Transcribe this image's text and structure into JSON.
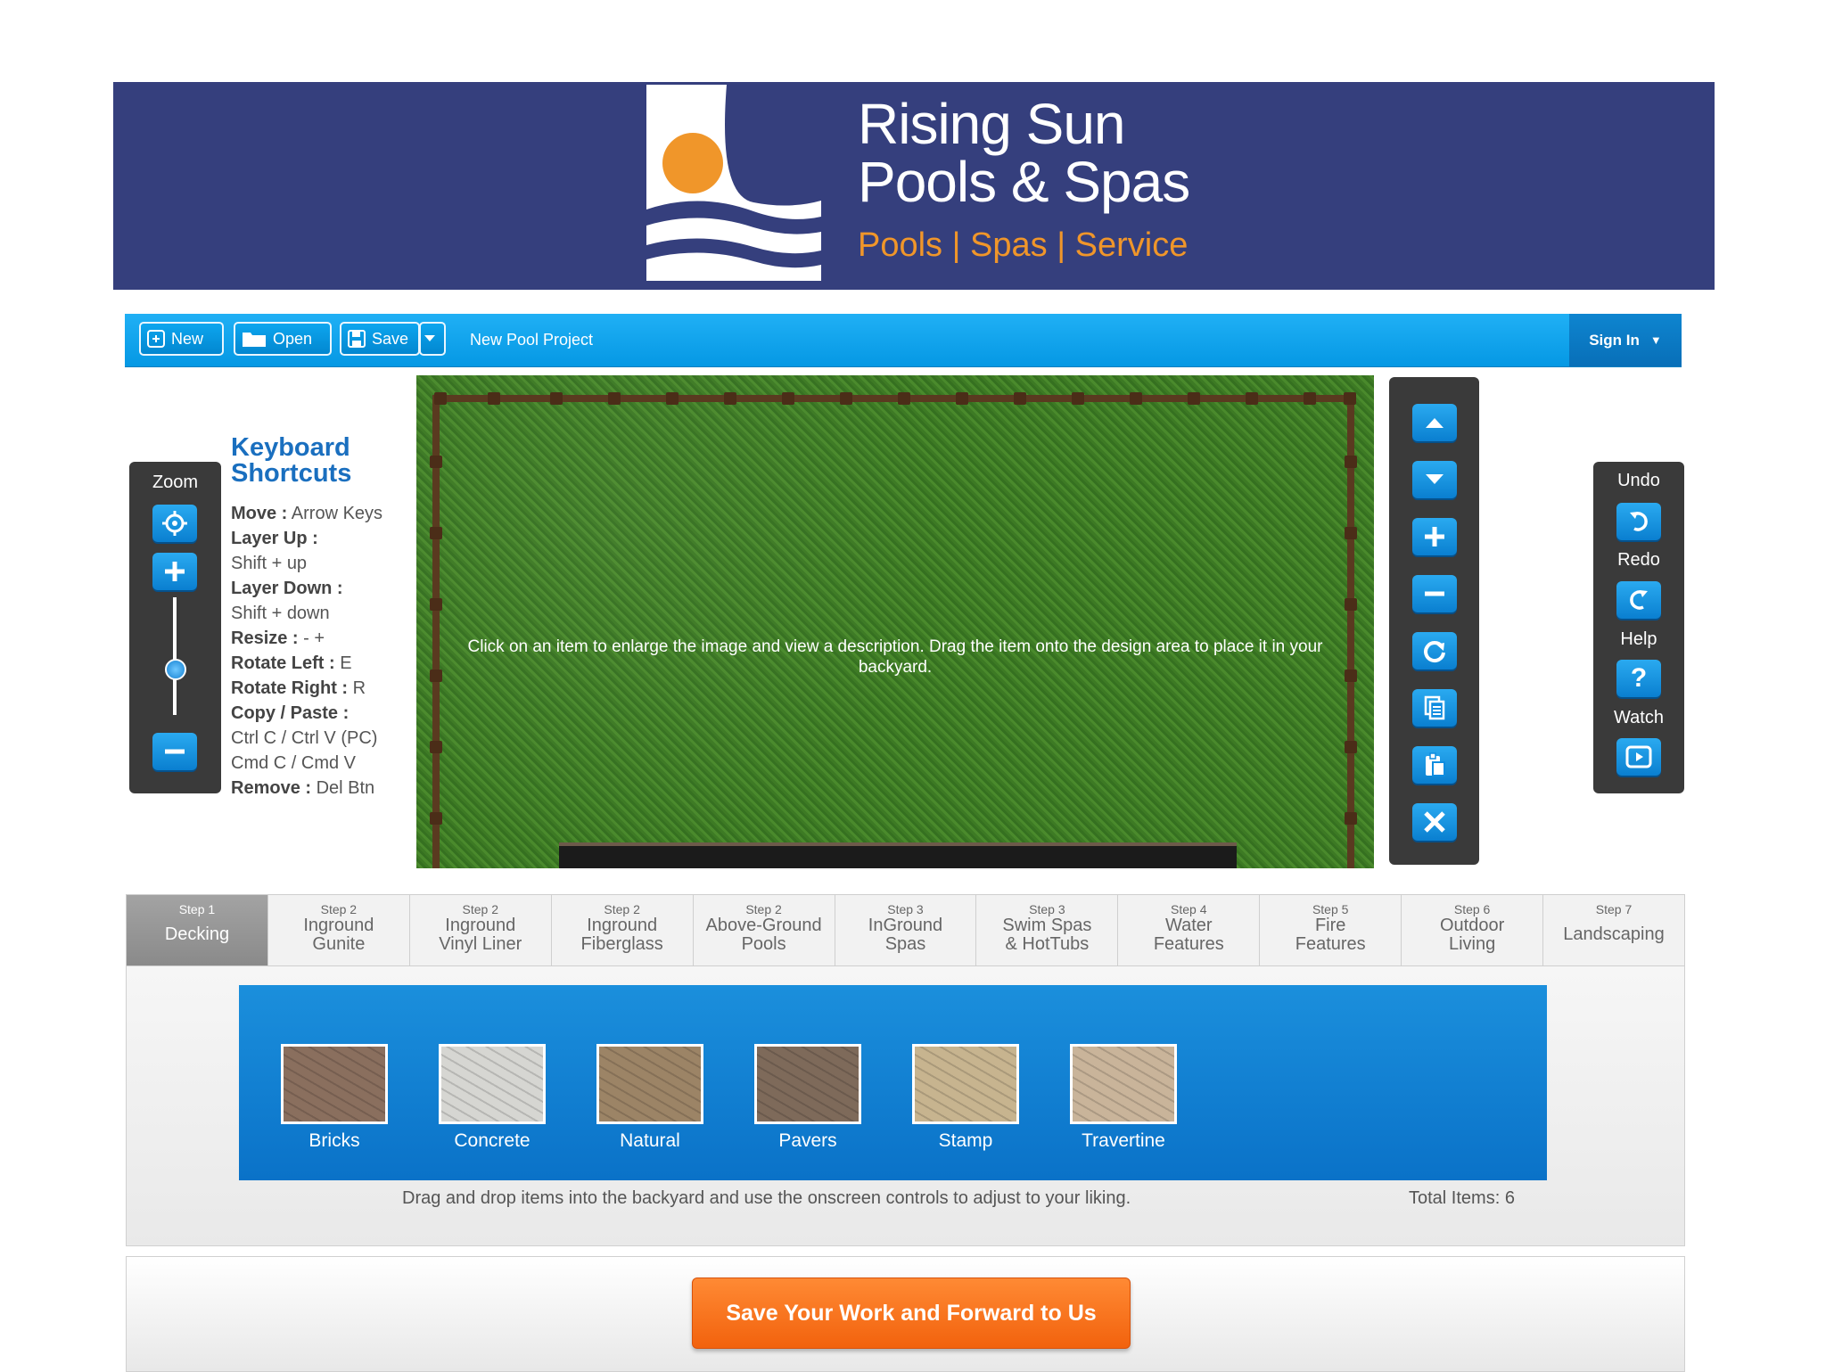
{
  "brand": {
    "line1": "Rising Sun",
    "line2": "Pools & Spas",
    "tagline": "Pools | Spas | Service",
    "colors": {
      "banner": "#353f7d",
      "sun": "#f0962a"
    }
  },
  "toolbar": {
    "new_label": "New",
    "open_label": "Open",
    "save_label": "Save",
    "project_title": "New Pool Project",
    "signin_label": "Sign In"
  },
  "zoom": {
    "label": "Zoom",
    "level": 0.4
  },
  "shortcuts": {
    "title": "Keyboard Shortcuts",
    "items": [
      {
        "key": "Move :",
        "value": "Arrow Keys"
      },
      {
        "key": "Layer Up :",
        "value": "Shift + up"
      },
      {
        "key": "Layer Down :",
        "value": "Shift + down"
      },
      {
        "key": "Resize :",
        "value": "- +"
      },
      {
        "key": "Rotate Left :",
        "value": "E"
      },
      {
        "key": "Rotate Right :",
        "value": "R"
      },
      {
        "key": "Copy / Paste :",
        "value": "Ctrl C / Ctrl V (PC)",
        "value2": "Cmd C / Cmd V"
      },
      {
        "key": "Remove :",
        "value": "Del Btn"
      }
    ]
  },
  "canvas": {
    "hint": "Click on an item to enlarge the image and view a description. Drag the item onto the design area to place it in your backyard."
  },
  "tools": [
    "move-up-icon",
    "move-down-icon",
    "plus-icon",
    "minus-icon",
    "rotate-icon",
    "copy-icon",
    "paste-icon",
    "delete-icon"
  ],
  "right_panel": {
    "undo": "Undo",
    "redo": "Redo",
    "help": "Help",
    "watch": "Watch"
  },
  "steps": [
    {
      "num": "Step 1",
      "name": "Decking",
      "active": true
    },
    {
      "num": "Step 2",
      "name": "Inground\nGunite"
    },
    {
      "num": "Step 2",
      "name": "Inground\nVinyl Liner"
    },
    {
      "num": "Step 2",
      "name": "Inground\nFiberglass"
    },
    {
      "num": "Step 2",
      "name": "Above-Ground\nPools"
    },
    {
      "num": "Step 3",
      "name": "InGround\nSpas"
    },
    {
      "num": "Step 3",
      "name": "Swim Spas\n& HotTubs"
    },
    {
      "num": "Step 4",
      "name": "Water\nFeatures"
    },
    {
      "num": "Step 5",
      "name": "Fire\nFeatures"
    },
    {
      "num": "Step 6",
      "name": "Outdoor\nLiving"
    },
    {
      "num": "Step 7",
      "name": "Landscaping"
    }
  ],
  "items": [
    {
      "label": "Bricks",
      "color": "#8a6f5e"
    },
    {
      "label": "Concrete",
      "color": "#d6d6d2"
    },
    {
      "label": "Natural",
      "color": "#9c8466"
    },
    {
      "label": "Pavers",
      "color": "#7e6a5a"
    },
    {
      "label": "Stamp",
      "color": "#c7b48f"
    },
    {
      "label": "Travertine",
      "color": "#c9b49a"
    }
  ],
  "drag_hint": "Drag and drop items into the backyard and use the onscreen controls to adjust to your liking.",
  "total_items": "Total Items: 6",
  "cta_label": "Save Your Work and Forward to Us"
}
